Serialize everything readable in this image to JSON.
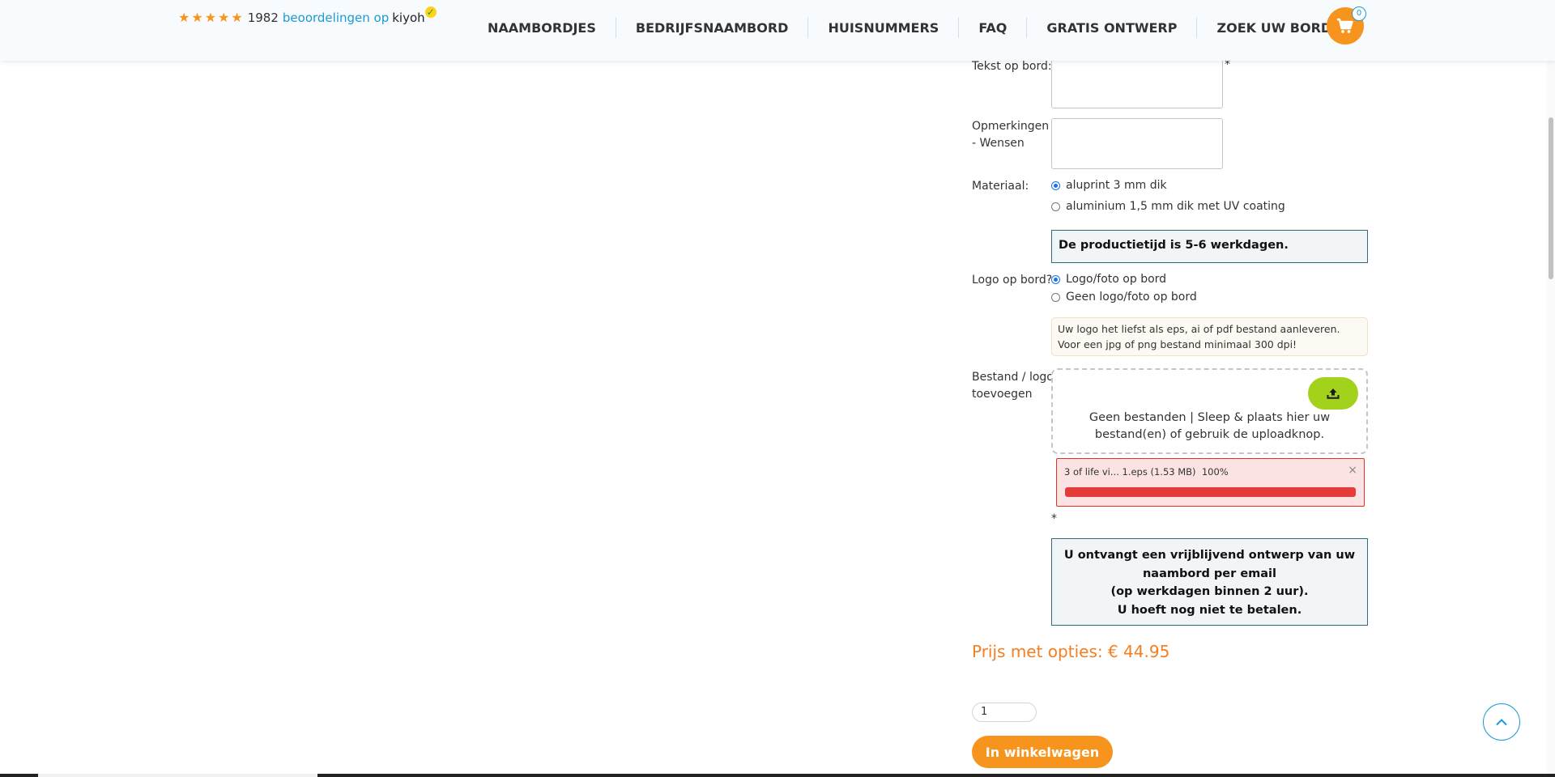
{
  "header": {
    "rating_count": "1982",
    "rating_link": "beoordelingen op",
    "rating_brand": "kiyoh",
    "nav": [
      "NAAMBORDJES",
      "BEDRIJFSNAAMBORD",
      "HUISNUMMERS",
      "FAQ",
      "GRATIS ONTWERP",
      "ZOEK UW BORD"
    ],
    "cart_count": "0",
    "colors": {
      "accent": "#f7941d",
      "link": "#1a9ad6"
    }
  },
  "form": {
    "tekst_label": "Tekst op bord:",
    "required_mark": "*",
    "opmerkingen_label_line1": "Opmerkingen",
    "opmerkingen_label_line2": "- Wensen",
    "materiaal_label": "Materiaal:",
    "materiaal_options": [
      {
        "label": "aluprint 3 mm dik",
        "checked": true
      },
      {
        "label": "aluminium 1,5 mm dik met UV coating",
        "checked": false
      }
    ],
    "productietijd": "De productietijd is 5-6 werkdagen.",
    "logo_label": "Logo op bord?",
    "logo_options": [
      {
        "label": "Logo/foto op bord",
        "checked": true
      },
      {
        "label": "Geen logo/foto op bord",
        "checked": false
      }
    ],
    "logo_note": "Uw logo het liefst als eps, ai of pdf bestand aanleveren. Voor een jpg of png bestand minimaal 300 dpi!",
    "bestand_label_line1": "Bestand / logo",
    "bestand_label_line2": "toevoegen",
    "dropzone_text": "Geen bestanden | Sleep & plaats hier uw bestand(en) of gebruik de uploadknop.",
    "file": {
      "name": "3 of life vi... 1.eps (1.53 MB)  100%",
      "remove": "×",
      "progress": 1.0
    },
    "ontwerp_lines": [
      "U ontvangt een vrijblijvend ontwerp van uw",
      "naambord per email",
      "(op werkdagen binnen 2 uur).",
      "U hoeft nog niet te betalen."
    ],
    "price": "Prijs met opties: € 44.95",
    "quantity": "1",
    "add_to_cart": "In winkelwagen"
  }
}
